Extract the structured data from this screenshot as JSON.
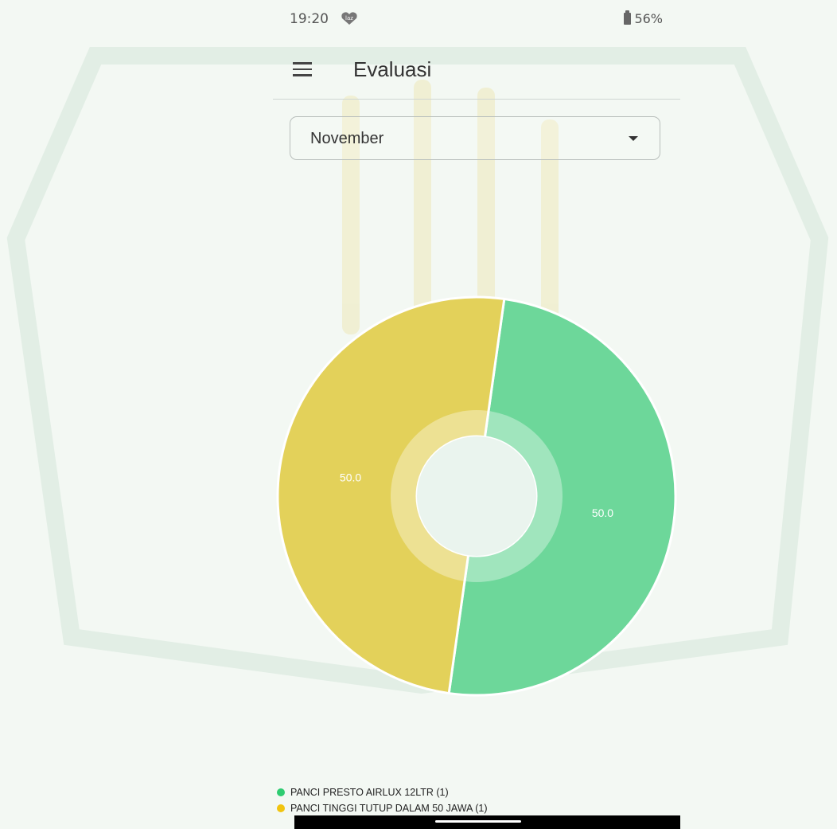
{
  "status_bar": {
    "time": "19:20",
    "battery": "56%"
  },
  "app_bar": {
    "title": "Evaluasi"
  },
  "filter": {
    "selected_month": "November"
  },
  "colors": {
    "green": "#6dd79a",
    "yellow": "#e3d15a",
    "legend_green": "#2ecc71",
    "legend_yellow": "#f1c40f"
  },
  "icons": {
    "menu": "menu-icon",
    "dropdown": "chevron-down-icon",
    "notification": "lazada-icon",
    "battery": "battery-icon"
  },
  "chart_data": {
    "type": "pie",
    "donut": true,
    "categories": [
      "PANCI PRESTO AIRLUX 12LTR (1)",
      "PANCI TINGGI TUTUP DALAM 50 JAWA  (1)"
    ],
    "values": [
      50.0,
      50.0
    ],
    "value_labels": [
      "50.0",
      "50.0"
    ],
    "legend_position": "bottom-left"
  }
}
